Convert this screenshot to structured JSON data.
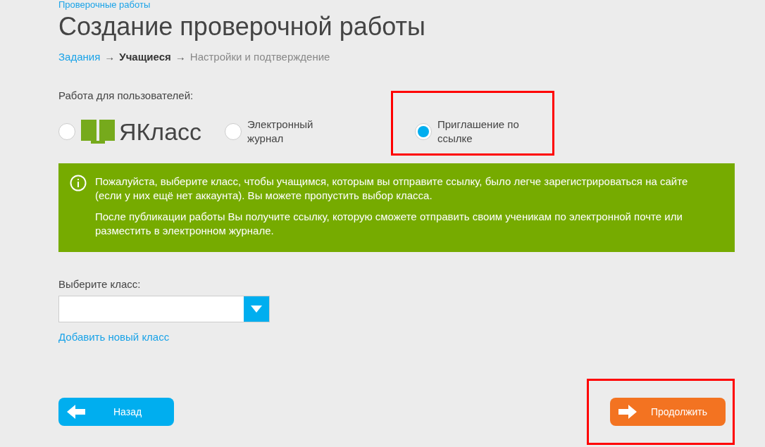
{
  "top_link": "Проверочные работы",
  "title": "Создание проверочной работы",
  "steps": [
    {
      "label": "Задания",
      "completed": true,
      "selected": false
    },
    {
      "label": "Учащиеся",
      "completed": false,
      "selected": true
    },
    {
      "label": "Настройки и подтверждение",
      "completed": false,
      "selected": false
    }
  ],
  "step_arrow": "→",
  "audience": {
    "label": "Работа для пользователей:",
    "options": [
      {
        "kind": "logo",
        "label": "ЯКласс",
        "selected": false,
        "highlighted": false
      },
      {
        "kind": "text",
        "label": "Электронный журнал",
        "selected": false,
        "highlighted": false
      },
      {
        "kind": "text",
        "label": "Приглашение по ссылке",
        "selected": true,
        "highlighted": true
      }
    ]
  },
  "notice": {
    "paragraphs": [
      "Пожалуйста, выберите класс, чтобы учащимся, которым вы отправите ссылку, было легче зарегистрироваться на сайте (если у них ещё нет аккаунта). Вы можете пропустить выбор класса.",
      "После публикации работы Вы получите ссылку, которую сможете отправить своим ученикам по электронной почте или разместить в электронном журнале."
    ]
  },
  "class_select": {
    "label": "Выберите класс:"
  },
  "add_class_link": "Добавить новый класс",
  "back_button": {
    "label": "Назад",
    "highlighted": false
  },
  "continue_button": {
    "label": "Продолжить",
    "highlighted": true
  }
}
